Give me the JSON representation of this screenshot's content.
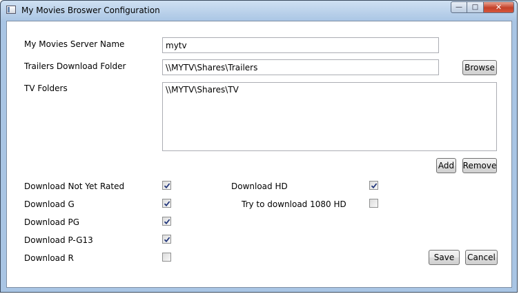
{
  "window": {
    "title": "My Movies Broswer Configuration"
  },
  "form": {
    "server_name_label": "My Movies Server Name",
    "server_name_value": "mytv",
    "trailers_folder_label": "Trailers Download Folder",
    "trailers_folder_value": "\\\\MYTV\\Shares\\Trailers",
    "browse_label": "Browse",
    "tv_folders_label": "TV Folders",
    "tv_folders_value": "\\\\MYTV\\Shares\\TV",
    "add_label": "Add",
    "remove_label": "Remove"
  },
  "options": {
    "not_yet_rated": {
      "label": "Download Not Yet Rated",
      "checked": true
    },
    "g": {
      "label": "Download G",
      "checked": true
    },
    "pg": {
      "label": "Download PG",
      "checked": true
    },
    "pg13": {
      "label": "Download P-G13",
      "checked": true
    },
    "r": {
      "label": "Download R",
      "checked": false
    },
    "hd": {
      "label": "Download HD",
      "checked": true
    },
    "hd1080": {
      "label": "Try to download 1080 HD",
      "checked": false
    }
  },
  "actions": {
    "save_label": "Save",
    "cancel_label": "Cancel"
  },
  "window_controls": {
    "minimize": "—",
    "maximize": "□",
    "close": "✕"
  }
}
